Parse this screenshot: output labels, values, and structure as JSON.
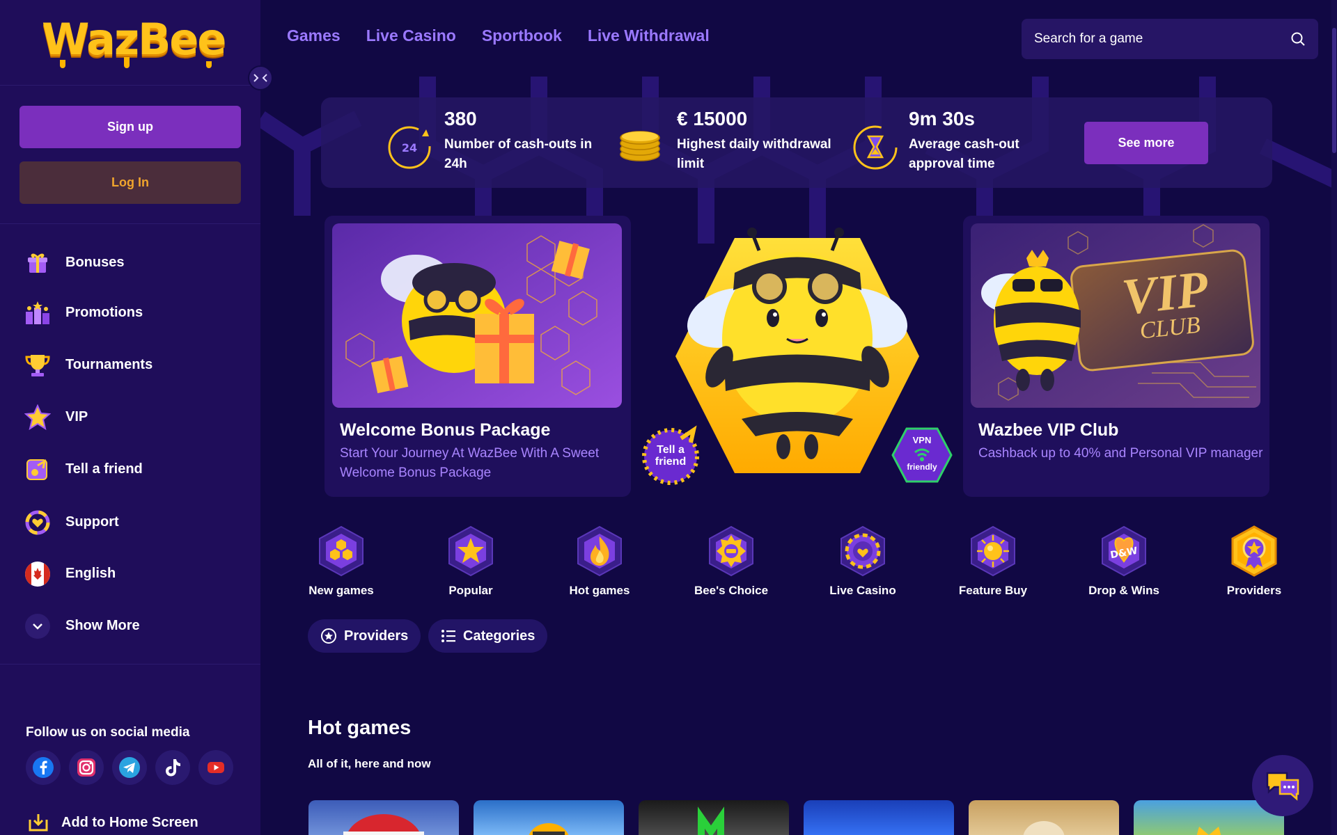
{
  "brand": {
    "logo_text": "WazBee"
  },
  "sidebar": {
    "signup_label": "Sign up",
    "login_label": "Log In",
    "items": [
      {
        "label": "Bonuses",
        "icon": "gift-icon"
      },
      {
        "label": "Promotions",
        "icon": "promotions-icon"
      },
      {
        "label": "Tournaments",
        "icon": "trophy-icon"
      },
      {
        "label": "VIP",
        "icon": "star-icon"
      },
      {
        "label": "Tell a friend",
        "icon": "tell-a-friend-icon"
      },
      {
        "label": "Support",
        "icon": "support-icon"
      },
      {
        "label": "English",
        "icon": "canada-flag-icon"
      },
      {
        "label": "Show More",
        "icon": "chevron-down-icon"
      }
    ],
    "social_title": "Follow us on social media",
    "social": [
      "facebook-icon",
      "instagram-icon",
      "telegram-icon",
      "tiktok-icon",
      "youtube-icon"
    ],
    "add_home_label": "Add to Home Screen"
  },
  "header": {
    "nav": [
      "Games",
      "Live Casino",
      "Sportbook",
      "Live Withdrawal"
    ],
    "search_placeholder": "Search for a game"
  },
  "stats": {
    "items": [
      {
        "value": "380",
        "label_line1": "Number of cash-outs in",
        "label_line2": "24h",
        "badge": "24"
      },
      {
        "value": "€ 15000",
        "label_line1": "Highest daily withdrawal",
        "label_line2": "limit"
      },
      {
        "value": "9m 30s",
        "label_line1": "Average cash-out",
        "label_line2": "approval time"
      }
    ],
    "see_more_label": "See more"
  },
  "promos": {
    "welcome": {
      "title": "Welcome Bonus Package",
      "desc": "Start Your Journey At WazBee With A Sweet Welcome Bonus Package"
    },
    "center": {
      "tell_badge_line1": "Tell a",
      "tell_badge_line2": "friend",
      "vpn_line1": "VPN",
      "vpn_line2": "friendly"
    },
    "vip": {
      "title": "Wazbee VIP Club",
      "desc": "Cashback up to 40% and Personal VIP manager",
      "img_text_1": "VIP",
      "img_text_2": "CLUB"
    }
  },
  "categories": [
    {
      "label": "New games",
      "icon": "new-games-icon"
    },
    {
      "label": "Popular",
      "icon": "popular-star-icon"
    },
    {
      "label": "Hot games",
      "icon": "fire-icon"
    },
    {
      "label": "Bee's Choice",
      "icon": "bees-choice-icon"
    },
    {
      "label": "Live Casino",
      "icon": "casino-chip-icon"
    },
    {
      "label": "Feature Buy",
      "icon": "feature-buy-icon"
    },
    {
      "label": "Drop & Wins",
      "icon": "drop-wins-icon",
      "badge": "D&W"
    },
    {
      "label": "Providers",
      "icon": "providers-medal-icon"
    }
  ],
  "filters": {
    "providers_label": "Providers",
    "categories_label": "Categories"
  },
  "section": {
    "title": "Hot games",
    "subtitle": "All of it, here and now"
  },
  "colors": {
    "background": "#110844",
    "sidebar": "#1f0d5a",
    "accent_purple": "#7b2fbd",
    "link_purple": "#9b79ff",
    "gold": "#ffc21a",
    "login_text": "#f0a52d"
  }
}
